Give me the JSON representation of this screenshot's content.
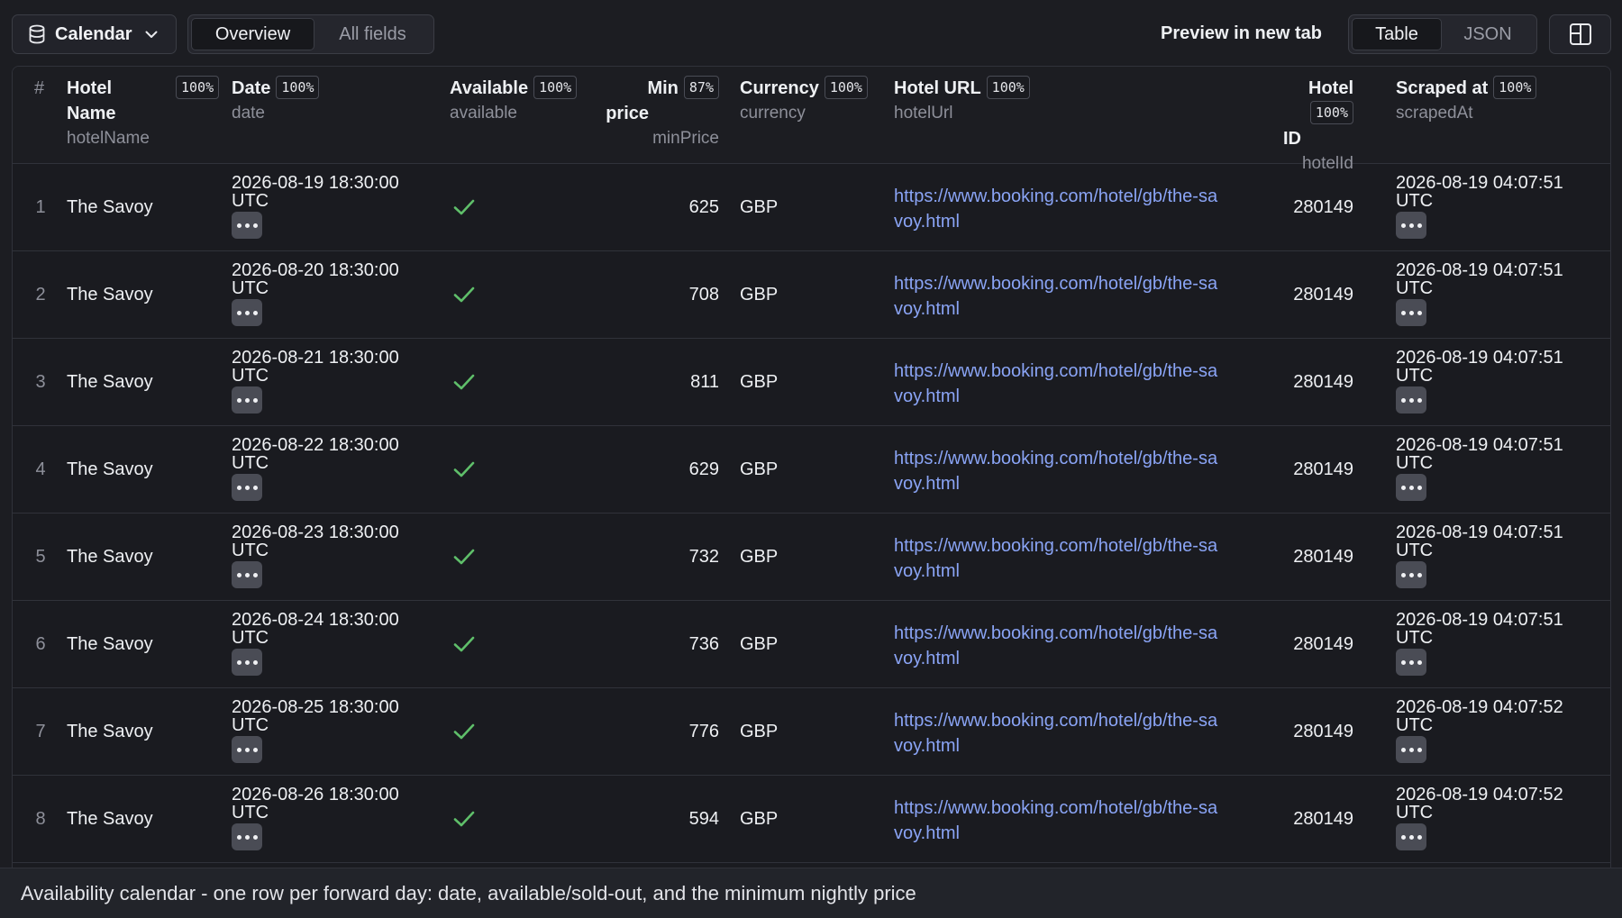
{
  "toolbar": {
    "dataset_label": "Calendar",
    "view_tabs": [
      "Overview",
      "All fields"
    ],
    "preview_label": "Preview in new tab",
    "format_tabs": [
      "Table",
      "JSON"
    ]
  },
  "columns": {
    "index": "#",
    "hotelName": {
      "label1": "Hotel",
      "label2": "Name",
      "key": "hotelName",
      "fill": "100%"
    },
    "date": {
      "label": "Date",
      "key": "date",
      "fill": "100%"
    },
    "available": {
      "label": "Available",
      "key": "available",
      "fill": "100%"
    },
    "minPrice": {
      "label1": "Min",
      "label2": "price",
      "key": "minPrice",
      "fill": "87%"
    },
    "currency": {
      "label": "Currency",
      "key": "currency",
      "fill": "100%"
    },
    "hotelUrl": {
      "label": "Hotel URL",
      "key": "hotelUrl",
      "fill": "100%"
    },
    "hotelId": {
      "label1": "Hotel",
      "label2": "ID",
      "key": "hotelId",
      "fill": "100%"
    },
    "scrapedAt": {
      "label": "Scraped at",
      "key": "scrapedAt",
      "fill": "100%"
    }
  },
  "rows": [
    {
      "n": "1",
      "name": "The Savoy",
      "date": "2026-08-19 18:30:00",
      "tz": "UTC",
      "price": "625",
      "currency": "GBP",
      "url1": "https://www.booking.com/hotel/gb/the-sa",
      "url2": "voy.html",
      "id": "280149",
      "scraped": "2026-08-19 04:07:51",
      "scraped_tz": "UTC"
    },
    {
      "n": "2",
      "name": "The Savoy",
      "date": "2026-08-20 18:30:00",
      "tz": "UTC",
      "price": "708",
      "currency": "GBP",
      "url1": "https://www.booking.com/hotel/gb/the-sa",
      "url2": "voy.html",
      "id": "280149",
      "scraped": "2026-08-19 04:07:51",
      "scraped_tz": "UTC"
    },
    {
      "n": "3",
      "name": "The Savoy",
      "date": "2026-08-21 18:30:00",
      "tz": "UTC",
      "price": "811",
      "currency": "GBP",
      "url1": "https://www.booking.com/hotel/gb/the-sa",
      "url2": "voy.html",
      "id": "280149",
      "scraped": "2026-08-19 04:07:51",
      "scraped_tz": "UTC"
    },
    {
      "n": "4",
      "name": "The Savoy",
      "date": "2026-08-22 18:30:00",
      "tz": "UTC",
      "price": "629",
      "currency": "GBP",
      "url1": "https://www.booking.com/hotel/gb/the-sa",
      "url2": "voy.html",
      "id": "280149",
      "scraped": "2026-08-19 04:07:51",
      "scraped_tz": "UTC"
    },
    {
      "n": "5",
      "name": "The Savoy",
      "date": "2026-08-23 18:30:00",
      "tz": "UTC",
      "price": "732",
      "currency": "GBP",
      "url1": "https://www.booking.com/hotel/gb/the-sa",
      "url2": "voy.html",
      "id": "280149",
      "scraped": "2026-08-19 04:07:51",
      "scraped_tz": "UTC"
    },
    {
      "n": "6",
      "name": "The Savoy",
      "date": "2026-08-24 18:30:00",
      "tz": "UTC",
      "price": "736",
      "currency": "GBP",
      "url1": "https://www.booking.com/hotel/gb/the-sa",
      "url2": "voy.html",
      "id": "280149",
      "scraped": "2026-08-19 04:07:51",
      "scraped_tz": "UTC"
    },
    {
      "n": "7",
      "name": "The Savoy",
      "date": "2026-08-25 18:30:00",
      "tz": "UTC",
      "price": "776",
      "currency": "GBP",
      "url1": "https://www.booking.com/hotel/gb/the-sa",
      "url2": "voy.html",
      "id": "280149",
      "scraped": "2026-08-19 04:07:52",
      "scraped_tz": "UTC"
    },
    {
      "n": "8",
      "name": "The Savoy",
      "date": "2026-08-26 18:30:00",
      "tz": "UTC",
      "price": "594",
      "currency": "GBP",
      "url1": "https://www.booking.com/hotel/gb/the-sa",
      "url2": "voy.html",
      "id": "280149",
      "scraped": "2026-08-19 04:07:52",
      "scraped_tz": "UTC"
    }
  ],
  "footer": {
    "description": "Availability calendar - one row per forward day: date, available/sold-out, and the minimum nightly price"
  },
  "colors": {
    "check": "#5fbf6a",
    "link": "#8aa4f5"
  }
}
